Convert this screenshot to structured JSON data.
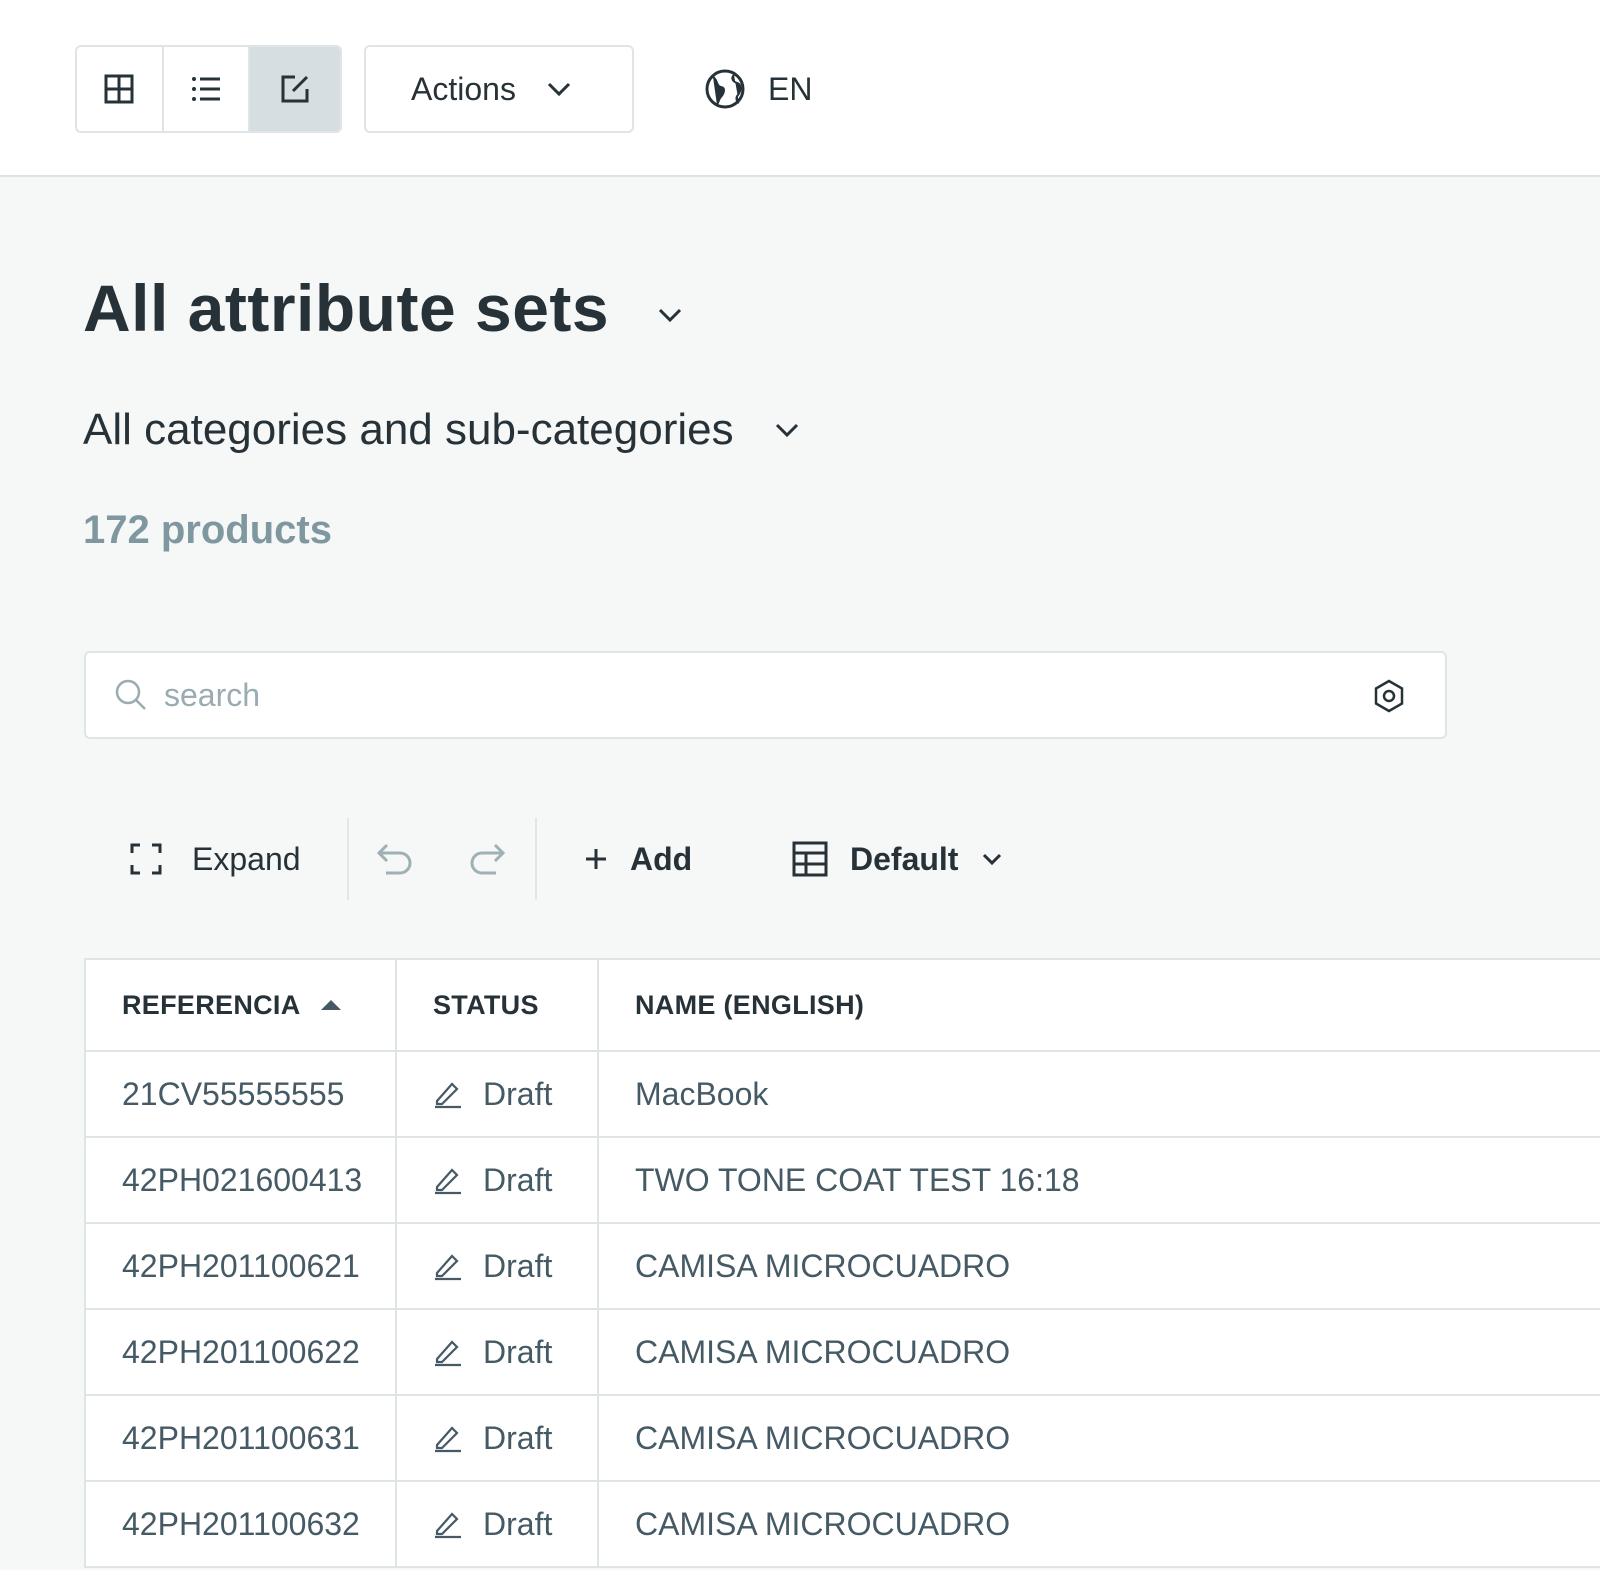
{
  "toolbar": {
    "view_modes": [
      {
        "icon": "grid-view-icon"
      },
      {
        "icon": "list-view-icon"
      },
      {
        "icon": "edit-view-icon",
        "active": true
      }
    ],
    "actions_label": "Actions",
    "language_label": "EN"
  },
  "page": {
    "title": "All attribute sets",
    "subtitle": "All categories and sub-categories",
    "count": "172 products"
  },
  "search": {
    "placeholder": "search"
  },
  "grid_toolbar": {
    "expand_label": "Expand",
    "add_label": "Add",
    "view_label": "Default"
  },
  "table": {
    "columns": [
      "REFERENCIA",
      "STATUS",
      "NAME (ENGLISH)"
    ],
    "rows": [
      {
        "ref": "21CV55555555",
        "status": "Draft",
        "name": "MacBook"
      },
      {
        "ref": "42PH021600413",
        "status": "Draft",
        "name": "TWO TONE COAT TEST 16:18"
      },
      {
        "ref": "42PH201100621",
        "status": "Draft",
        "name": "CAMISA MICROCUADRO"
      },
      {
        "ref": "42PH201100622",
        "status": "Draft",
        "name": "CAMISA MICROCUADRO"
      },
      {
        "ref": "42PH201100631",
        "status": "Draft",
        "name": "CAMISA MICROCUADRO"
      },
      {
        "ref": "42PH201100632",
        "status": "Draft",
        "name": "CAMISA MICROCUADRO"
      }
    ]
  },
  "colors": {
    "text_primary": "#263238",
    "text_muted": "#7f979f",
    "border": "#dfe4e6",
    "active_view_bg": "#d6dee1",
    "page_bg": "#f6f7f7"
  }
}
